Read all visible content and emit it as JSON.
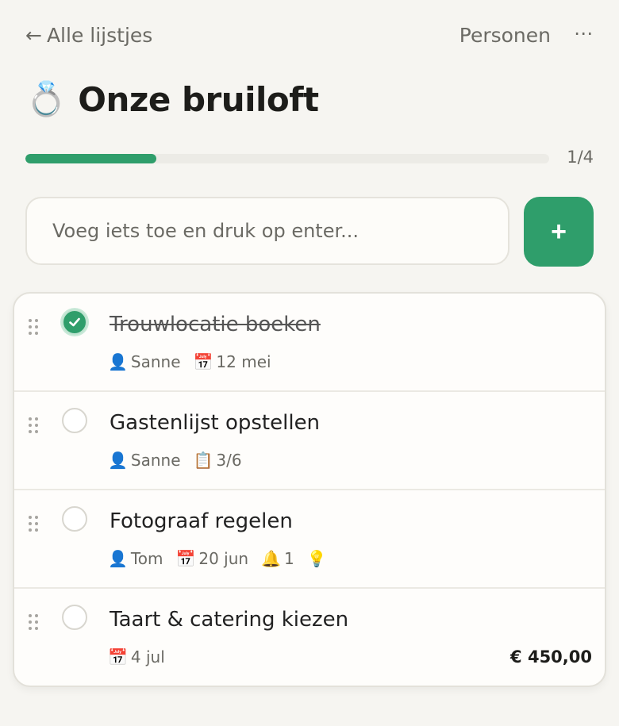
{
  "header": {
    "back_arrow": "←",
    "back_label": "Alle lijstjes",
    "people_label": "Personen",
    "more_label": "⋯"
  },
  "list": {
    "emoji": "💍",
    "title": "Onze bruiloft",
    "progress_text": "1/4",
    "progress_value": 0.25
  },
  "add": {
    "placeholder": "Voeg iets toe en druk op enter...",
    "button_label": "+"
  },
  "items": [
    {
      "title": "Trouwlocatie boeken",
      "done": true,
      "meta": [
        {
          "icon": "👤",
          "text": "Sanne"
        },
        {
          "icon": "📅",
          "text": "12 mei"
        }
      ],
      "price": ""
    },
    {
      "title": "Gastenlijst opstellen",
      "done": false,
      "meta": [
        {
          "icon": "👤",
          "text": "Sanne"
        },
        {
          "icon": "📋",
          "text": "3/6"
        }
      ],
      "price": ""
    },
    {
      "title": "Fotograaf regelen",
      "done": false,
      "meta": [
        {
          "icon": "👤",
          "text": "Tom"
        },
        {
          "icon": "📅",
          "text": "20 jun"
        },
        {
          "icon": "🔔",
          "text": "1"
        },
        {
          "icon": "💡",
          "text": ""
        }
      ],
      "price": ""
    },
    {
      "title": "Taart & catering kiezen",
      "done": false,
      "meta": [
        {
          "icon": "📅",
          "text": "4 jul"
        }
      ],
      "price": "€ 450,00"
    }
  ],
  "colors": {
    "accent": "#2f9e6b",
    "background": "#f6f5f1",
    "text_muted": "#6b6a64"
  }
}
